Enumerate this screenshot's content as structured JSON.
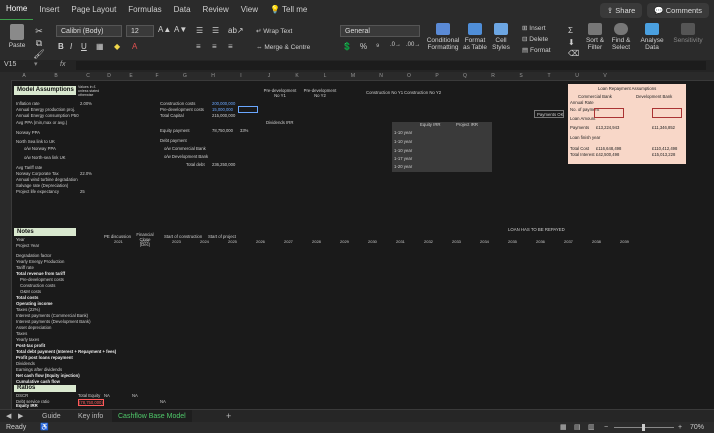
{
  "menu": {
    "tabs": [
      "Home",
      "Insert",
      "Page Layout",
      "Formulas",
      "Data",
      "Review",
      "View"
    ],
    "tell_me": "Tell me",
    "share": "Share",
    "comments": "Comments"
  },
  "ribbon": {
    "paste": "Paste",
    "font_name": "Calibri (Body)",
    "font_size": "12",
    "wrap_text": "Wrap Text",
    "merge_centre": "Merge & Centre",
    "number_format": "General",
    "conditional": "Conditional Formatting",
    "format_table": "Format as Table",
    "cell_styles": "Cell Styles",
    "insert": "Insert",
    "delete": "Delete",
    "format": "Format",
    "sort_filter": "Sort & Filter",
    "find_select": "Find & Select",
    "analyse": "Analyse Data",
    "sensitivity": "Sensitivity"
  },
  "formula_bar": {
    "cell_ref": "V15",
    "fx": "fx"
  },
  "columns": [
    "A",
    "B",
    "C",
    "D",
    "E",
    "F",
    "G",
    "H",
    "I",
    "J",
    "K",
    "L",
    "M",
    "N",
    "O",
    "P",
    "Q",
    "R",
    "S",
    "T",
    "U",
    "V"
  ],
  "sheet": {
    "model_assumptions": "Model Assumptions",
    "values_note": "Values in £ unless stated otherwise",
    "assumption_labels": [
      "Inflation rate",
      "Annual Energy production proj.",
      "Annual Energy consumption P50",
      "Avg PPA (min,max or avg.)",
      "Norway PPA",
      "North Sea link to UK",
      "o/w Norway PPA",
      "o/w North-sea link UK",
      "Avg Tariff rate",
      "Norway Corporate Tax",
      "Annual wind turbine degradation",
      "Salvage rate (Depreciation)",
      "Project life expectancy"
    ],
    "assumption_values": [
      "2.00%",
      "",
      "",
      "",
      "",
      "",
      "",
      "",
      "",
      "22.0%",
      "",
      "",
      "25"
    ],
    "construction": {
      "costs_label": "Construction costs",
      "costs_val": "200,000,000",
      "predev_label": "Pre-development costs",
      "predev_val": "15,000,000",
      "total_label": "Total Capital",
      "total_val": "215,000,000"
    },
    "equity": {
      "equity_label": "Equity payment",
      "equity_val": "78,750,000",
      "equity_pct": "33%",
      "debt_label": "Debt payment",
      "debt_val": "",
      "o_w_commercial": "o/w Commercial Bank",
      "o_w_dev": "o/w Development Bank",
      "total_debt": "Total debt",
      "total_debt_val": "236,250,000",
      "dividends": "Dividends IRR"
    },
    "headers_top": [
      "Pre-development No Y1",
      "Pre-development No Y2",
      "Construction No Y1",
      "Construction No Y2"
    ],
    "irr_table": {
      "headers": [
        "Equity IRR",
        "Project IRR"
      ],
      "rows": [
        "1-10 year",
        "1-10 year",
        "1-10 year",
        "1-17 year",
        "1-20 year"
      ]
    },
    "loan_title": "Loan Repayment Assumptions",
    "commercial_bank": "Commercial Bank",
    "development_bank": "Development Bank",
    "loan_rows": [
      "Annual Rate",
      "No. of payment",
      "Loan Amount",
      "Payments",
      "Loan finish year",
      "Total Cost",
      "Total Interest"
    ],
    "payments_ok": "Payments OK",
    "loan_values_left": [
      "",
      "",
      "",
      "£13,224,943",
      "",
      "£116,648,498",
      "£42,500,498"
    ],
    "loan_values_right": [
      "",
      "",
      "",
      "£11,346,852",
      "",
      "£110,412,498",
      "£15,013,228"
    ],
    "notes": "Notes",
    "year_label": "Year",
    "project_year": "Project Year",
    "timeline": [
      "PE discussion",
      "Financial Close (Dec)",
      "Start of construction",
      "Start of project"
    ],
    "years": [
      "2021",
      "2022",
      "2023",
      "2024",
      "2025",
      "2026",
      "2027",
      "2028",
      "2029",
      "2030",
      "2031",
      "2032",
      "2033",
      "2034",
      "2035",
      "2036",
      "2037",
      "2038",
      "2039"
    ],
    "loan_note": "LOAN HAS TO BE REPAYED",
    "row_labels": [
      "Degradation factor",
      "Yearly Energy Production",
      "Tariff rate",
      "Total revenue from tariff",
      "Pre-development costs",
      "Construction costs",
      "O&M costs",
      "Total costs",
      "Operating income",
      "Taxes (22%)",
      "Interest payments (Commercial Bank)",
      "Interest payments (Development Bank)",
      "Asset depreciation",
      "Taxes",
      "Yearly taxes",
      "Post-tax profit",
      "Total debt payment (Interest + Repayment + fees)",
      "Profit post loans repayment",
      "Dividends",
      "Earnings after dividends",
      "Net cash flow (Equity injection)",
      "Cumulative cash flow"
    ],
    "ratios": "Ratios",
    "ratio_labels": [
      "DSCR",
      "Debt service ratio",
      "Equity IRR",
      "Project IRR"
    ],
    "ratio_side": [
      "Total Equity",
      "(78,750,000)",
      "(215,000,000)"
    ],
    "na": "NA"
  },
  "sheet_tabs": [
    "Guide",
    "Key info",
    "Cashflow Base Model"
  ],
  "status": {
    "ready": "Ready",
    "zoom": "70%"
  }
}
